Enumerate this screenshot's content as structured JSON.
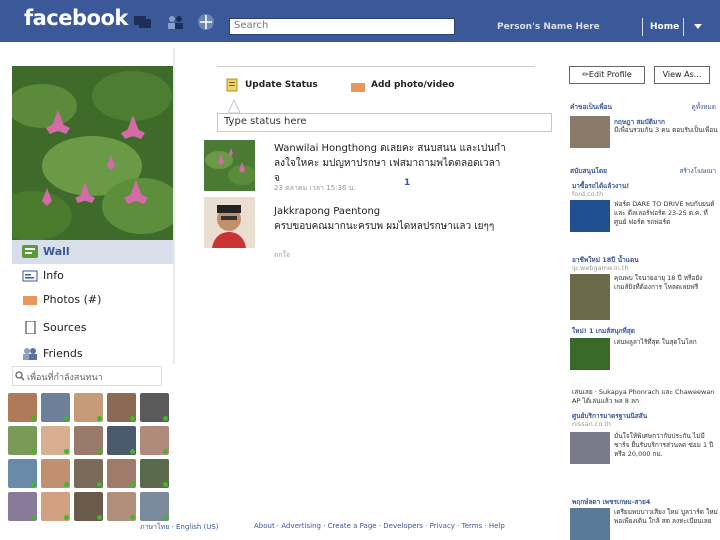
{
  "topbar": {
    "logo": "facebook",
    "search_placeholder": "Search",
    "person_name": "Person's Name Here",
    "home": "Home"
  },
  "profile": {
    "nav": [
      {
        "label": "Wall",
        "icon": "wall-icon"
      },
      {
        "label": "Info",
        "icon": "info-icon"
      },
      {
        "label": "Photos (#)",
        "icon": "photos-icon"
      },
      {
        "label": "Sources",
        "icon": "sources-icon"
      },
      {
        "label": "Friends",
        "icon": "friends-icon"
      }
    ],
    "friends_search_label": "เพื่อนที่กำลังสนทนา"
  },
  "composer": {
    "update_status": "Update Status",
    "add_photo": "Add photo/video",
    "status_placeholder": "Type status here"
  },
  "posts": [
    {
      "author": "Wanwilai Hongthong",
      "text": "ดเลยคะ สนบสนน และเปนกำลงใจใหคะ มปญหาปรกษา เฟสมาถามพไดตลอดเวลาจ",
      "meta": "23 ตลาคม เวลา 15:36 น.",
      "likes": "1"
    },
    {
      "author": "Jakkrapong Paentong",
      "text": "ครบขอบคณมากนะครบพ ผมไดหลปรกษาแลว เยๆๆ",
      "meta": "ถกใจ"
    }
  ],
  "right": {
    "edit_profile": "Edit Profile",
    "view_as": "View As...",
    "sections": [
      {
        "title": "คำขอเป็นเพื่อน",
        "link": "ดูทั้งหมด"
      },
      {
        "title": "สนับสนุนโดย",
        "link": "สร้างโฆษณา"
      }
    ],
    "friend_request": {
      "name": "กฤษฎา สมบัติมาก",
      "text": "มีเพื่อนรวมกัน 3 คน ตอบรับเป็นเพื่อน"
    },
    "ads": [
      {
        "title": "มาซื้อรถได้แล้วงาน!",
        "url": "ford.co.th",
        "text": "ฟอร์ด DARE TO DRIVE พบกับยนต์และ ดีลเลอร์ฟอร์ด 23-25 ต.ค. ที่ศูนย์ ฟอร์ด รถฟอร์ด"
      },
      {
        "title": "อาชีพใหม่ 18ปี น้ำแดน",
        "url": "ip.webgame.in.th",
        "text": "คุณพบ ใจนายอายุ 18 ปี หรือยัง เกมส์ยิงที่ต้องการ โหลดเลยฟรี"
      },
      {
        "title": "ใหม่! 1 เกมส์สนุกที่สุด",
        "url": "",
        "text": "เล่นพลูลาไร้ที่สุด ในสุดในโลก"
      },
      {
        "title": "",
        "url": "",
        "text": "เล่นเลย · Sukapya Phonrach และ Chaweewan AP ได้เล่นแล้ว พล 8 ลก"
      },
      {
        "title": "ศูนย์บริการมาตรฐานนิสสัน",
        "url": "nissan.co.th",
        "text": "มั่นใจให้พิเศษกว่ากับประกัน ไม่มีชาร์จ ยื่นรับบริการส่วนลด ซ่อม 1 ปีหรือ 20,000 กม."
      },
      {
        "title": "พฤกษ์ลดา เพชรเกษม-สาย4",
        "url": "",
        "text": "เตรียมพบบาวเสียง ใหม่ บูลวาร์ด ใหม่ พอเพียงเดิน ใกล้ สต ลงทะเบียนเลย"
      }
    ]
  },
  "footer": {
    "language": "ภาษาไทย · English (US)",
    "links": "About · Advertising · Create a Page · Developers · Privacy · Terms · Help"
  }
}
